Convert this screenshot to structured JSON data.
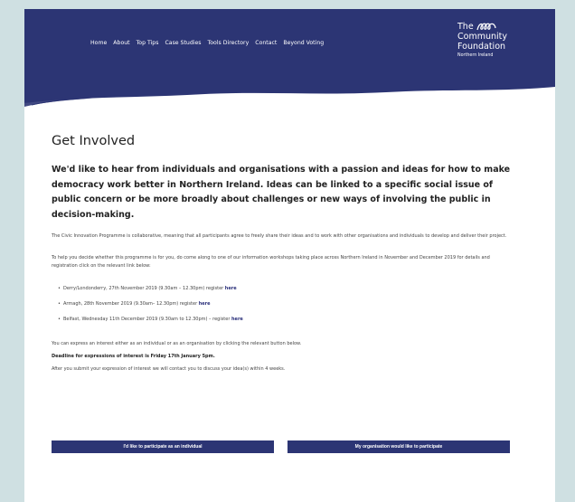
{
  "nav": {
    "items": [
      "Home",
      "About",
      "Top Tips",
      "Case Studies",
      "Tools Directory",
      "Contact",
      "Beyond Voting"
    ]
  },
  "logo": {
    "line1": "The",
    "line2": "Community",
    "line3": "Foundation",
    "line4": "Northern Ireland"
  },
  "main": {
    "title": "Get Involved",
    "lead": "We'd like to hear from individuals and organisations with a passion and ideas for how to make democracy work better in Northern Ireland. Ideas can be linked to a specific social issue of public concern or be more broadly about challenges or new ways of involving the public in decision-making.",
    "para1": "The Civic Innovation Programme is collaborative, meaning that all participants agree to freely share their ideas and to work with other organisations and individuals to develop and deliver their project.",
    "para2": "To help you decide whether this programme is for you, do come along to one of our information workshops taking place across Northern Ireland in November and December 2019 for details and registration click on the relevant link below:",
    "events": [
      {
        "text": "Derry/Londonderry, 27th November 2019 (9.30am – 12.30pm) register ",
        "link": "here"
      },
      {
        "text": "Armagh, 28th November 2019 (9.30am– 12.30pm) register ",
        "link": "here"
      },
      {
        "text": "Belfast, Wednesday 11th December 2019 (9.30am to 12.30pm) – register ",
        "link": "here"
      }
    ],
    "para3": "You can express an interest either as an individual or as an organisation by clicking the relevant button below.",
    "deadline": "Deadline for expressions of interest is Friday 17th January 5pm.",
    "para4": "After you submit your expression of interest we will contact you to discuss your idea(s) within 4 weeks."
  },
  "buttons": {
    "individual": "I'd like to participate as an individual",
    "organisation": "My organisation would like to participate"
  },
  "colors": {
    "header_bg": "#2c3574",
    "page_bg": "#cfe0e2",
    "button_bg": "#2c3574",
    "link": "#2a2f7a"
  }
}
